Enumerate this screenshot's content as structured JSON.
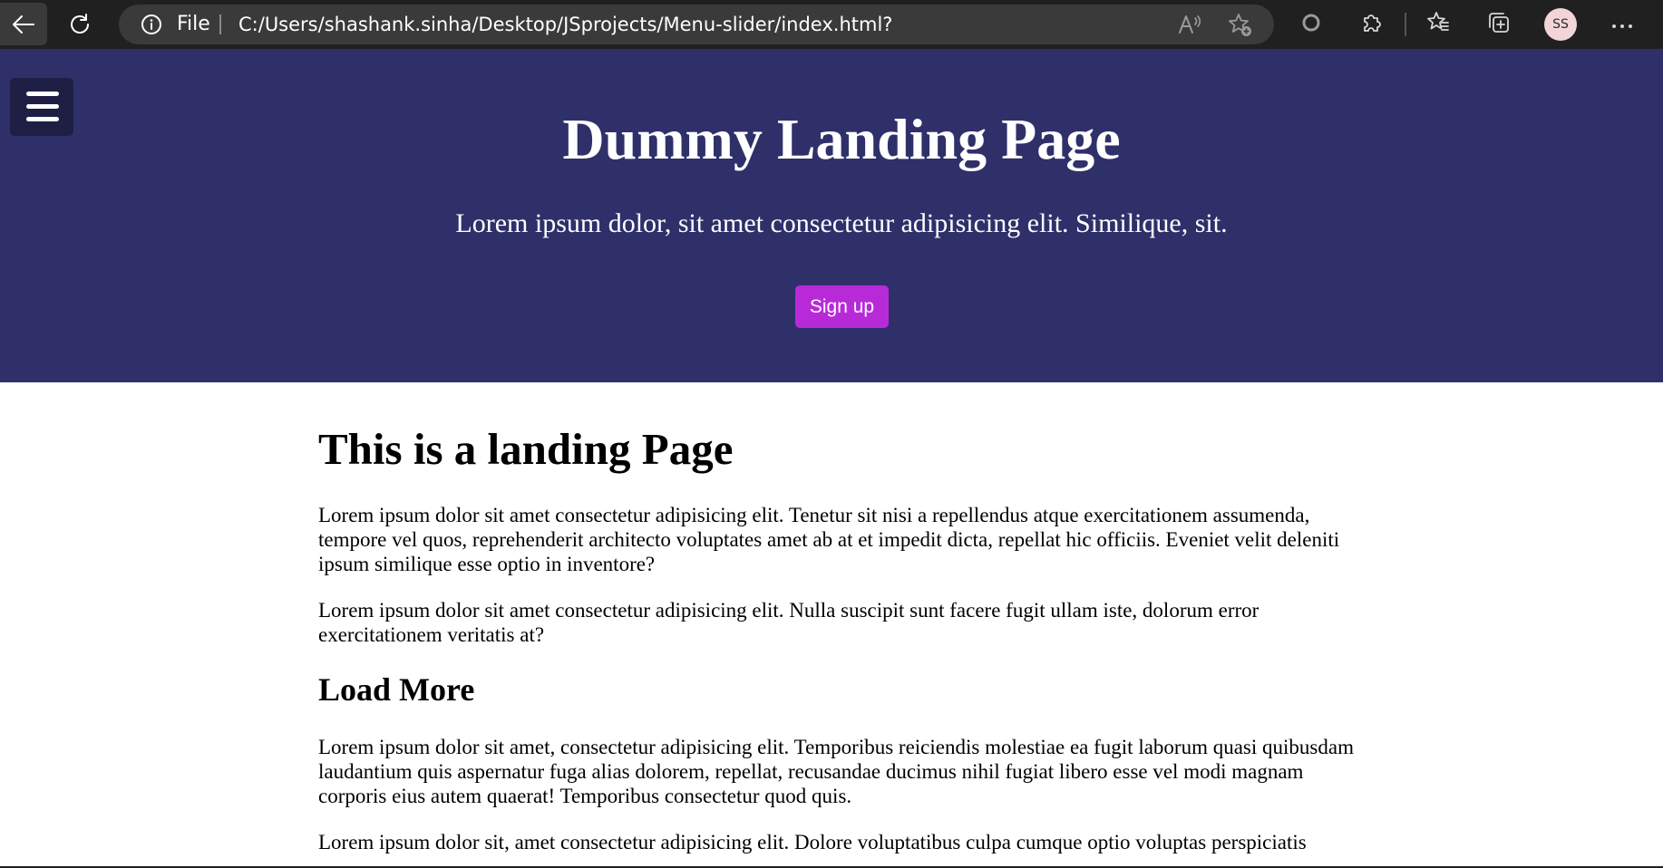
{
  "browser": {
    "address_scheme": "File",
    "url": "C:/Users/shashank.sinha/Desktop/JSprojects/Menu-slider/index.html?",
    "profile_initials": "SS",
    "icons": {
      "back": "arrow-left-icon",
      "refresh": "refresh-icon",
      "info": "info-icon",
      "read_aloud": "read-aloud-icon",
      "add_favorite": "star-add-icon",
      "circle": "circle-icon",
      "extensions": "puzzle-icon",
      "favorites": "favorites-star-icon",
      "collections": "collections-icon",
      "more": "more-dots-icon"
    }
  },
  "hero": {
    "title": "Dummy Landing Page",
    "subtitle": "Lorem ipsum dolor, sit amet consectetur adipisicing elit. Similique, sit.",
    "signup_label": "Sign up",
    "menu_icon": "hamburger-icon"
  },
  "main": {
    "heading": "This is a landing Page",
    "paragraph1": "Lorem ipsum dolor sit amet consectetur adipisicing elit. Tenetur sit nisi a repellendus atque exercitationem assumenda, tempore vel quos, reprehenderit architecto voluptates amet ab at et impedit dicta, repellat hic officiis. Eveniet velit deleniti ipsum similique esse optio in inventore?",
    "paragraph2": "Lorem ipsum dolor sit amet consectetur adipisicing elit. Nulla suscipit sunt facere fugit ullam iste, dolorum error exercitationem veritatis at?",
    "subheading": "Load More",
    "paragraph3": "Lorem ipsum dolor sit amet, consectetur adipisicing elit. Temporibus reiciendis molestiae ea fugit laborum quasi quibusdam laudantium quis aspernatur fuga alias dolorem, repellat, recusandae ducimus nihil fugiat libero esse vel modi magnam corporis eius autem quaerat! Temporibus consectetur quod quis.",
    "paragraph4": "Lorem ipsum dolor sit, amet consectetur adipisicing elit. Dolore voluptatibus culpa cumque optio voluptas perspiciatis"
  },
  "colors": {
    "hero_background": "#2f306a",
    "signup_button": "#b82ad8",
    "menu_button": "#1f1f45",
    "chrome_background": "#202020",
    "address_bar": "#3a3a3a"
  }
}
